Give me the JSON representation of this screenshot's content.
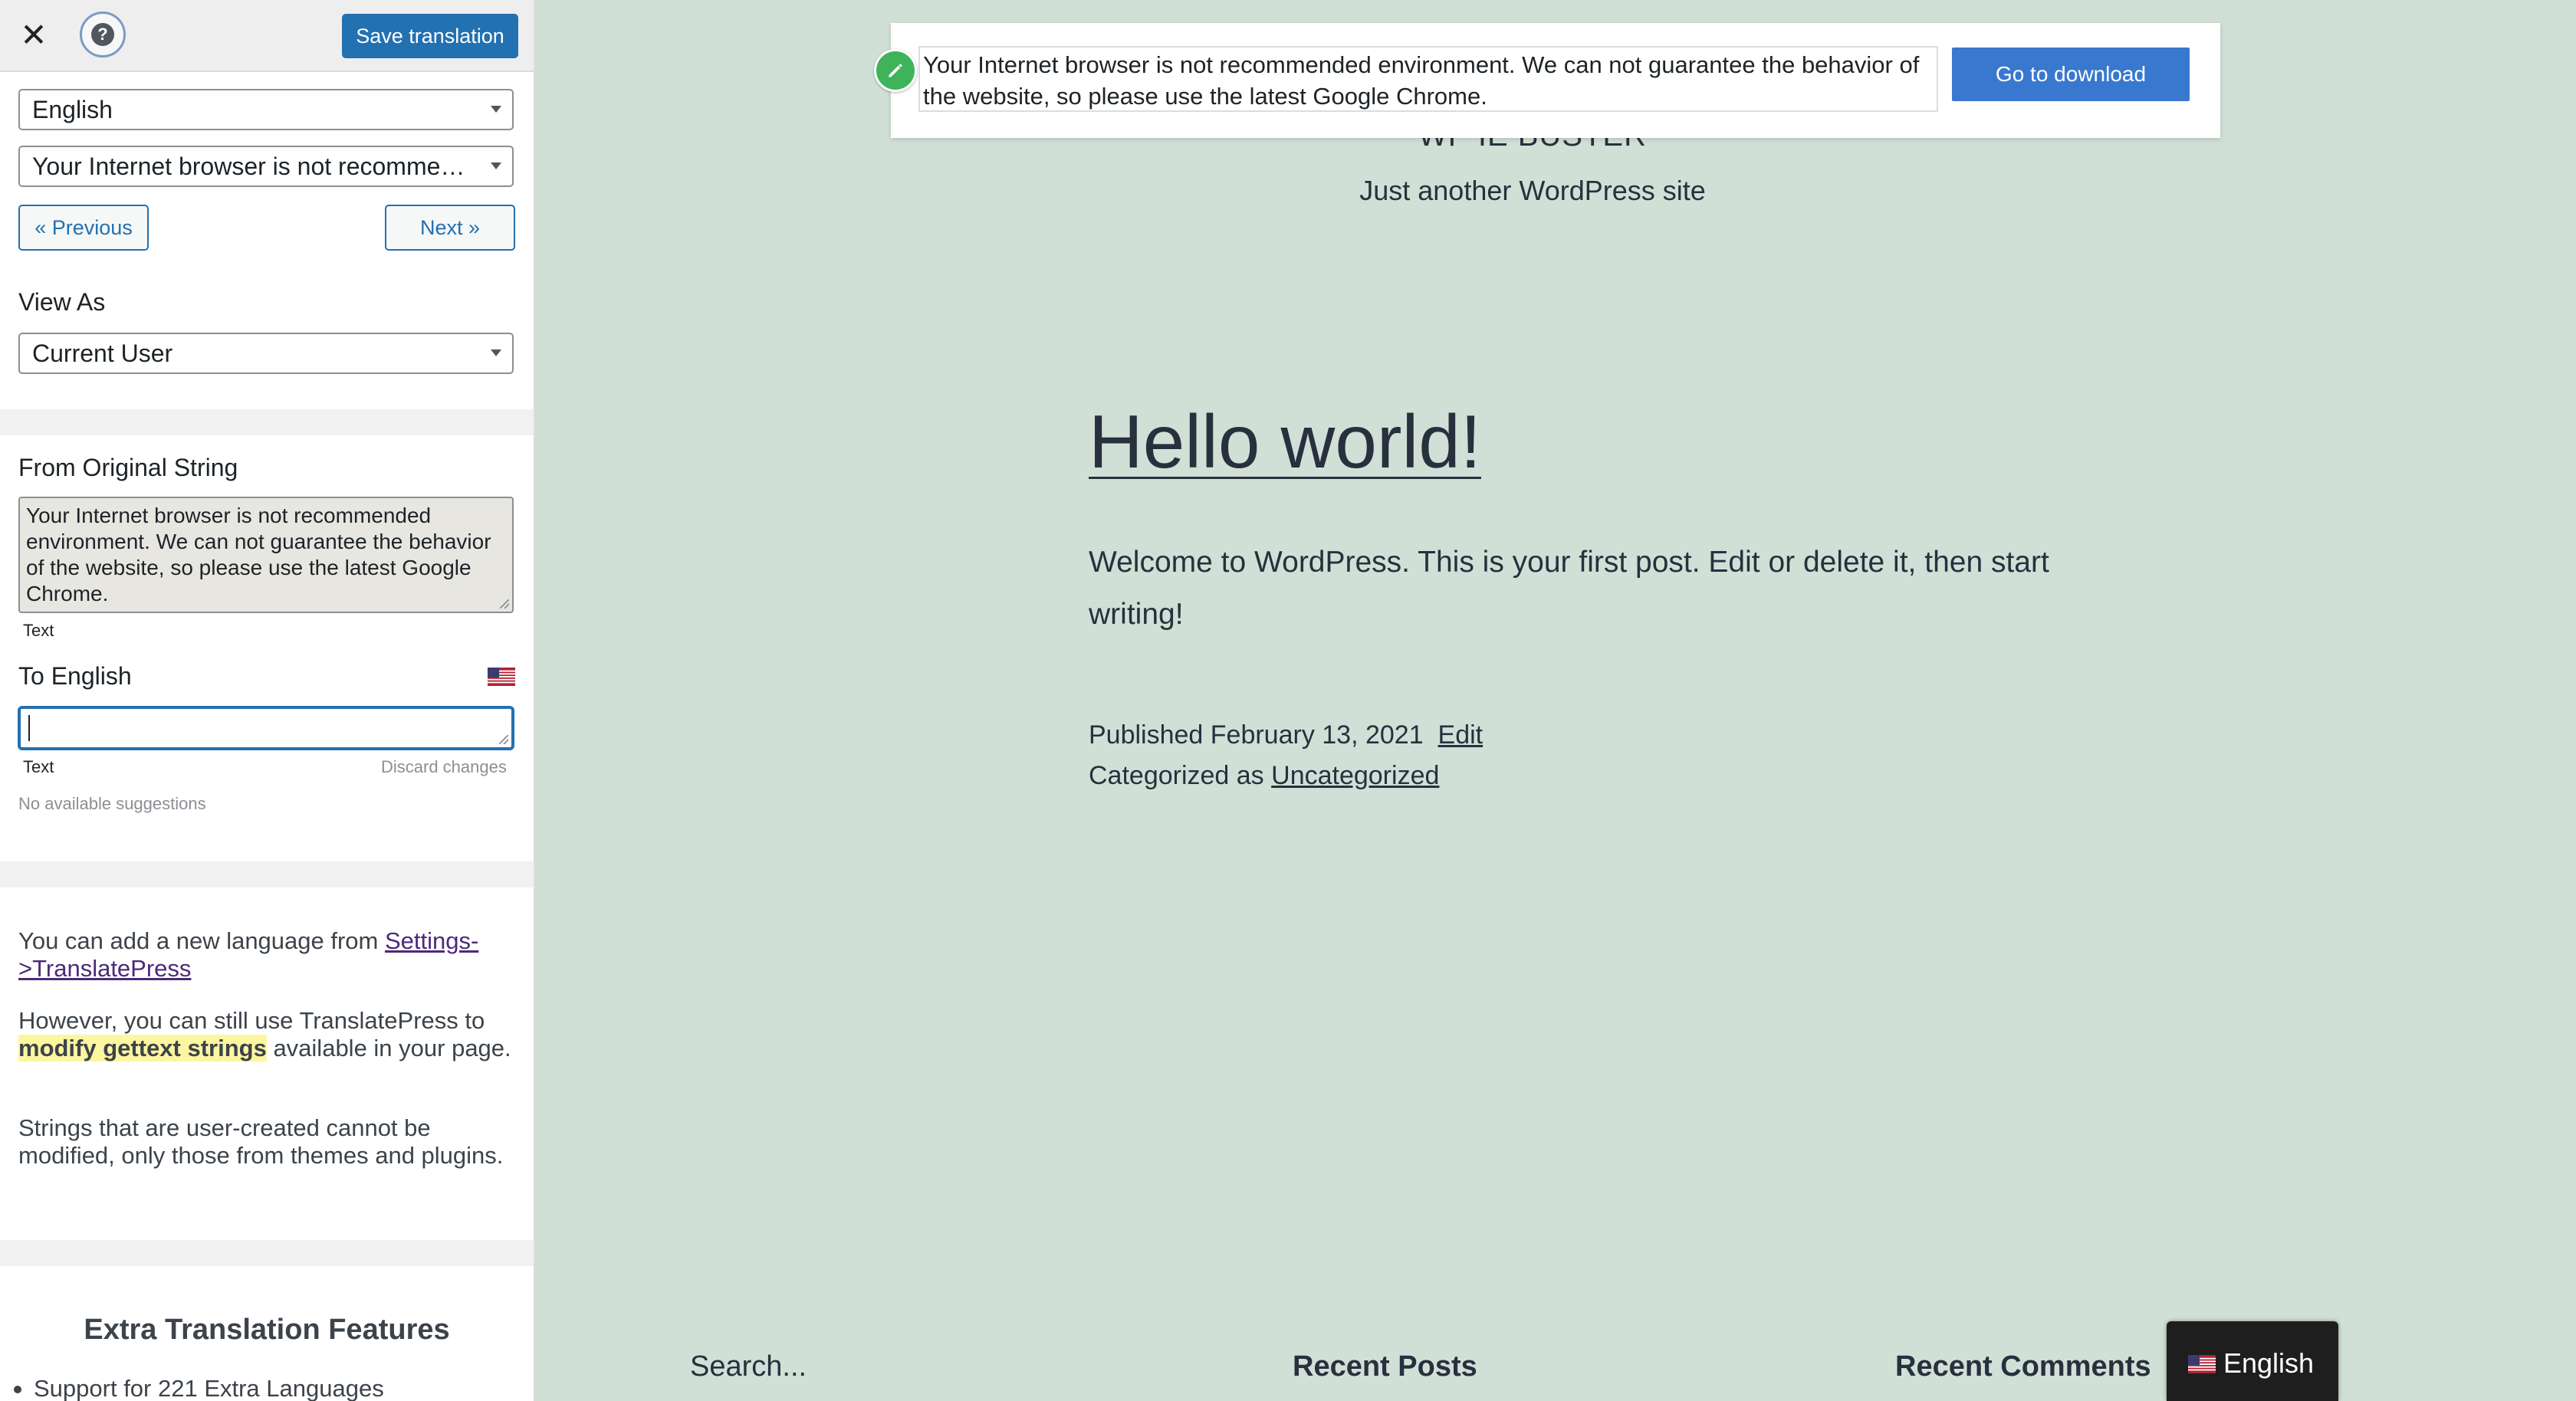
{
  "sidebar": {
    "save_label": "Save translation",
    "language_select": "English",
    "string_select": "Your Internet browser is not recommended environment. We can not guarantee the behavior of the website, so please use the latest Google Chrome.",
    "prev_label": "« Previous",
    "next_label": "Next »",
    "view_as_label": "View As",
    "view_as_value": "Current User",
    "from_label": "From Original String",
    "original_text": "Your Internet browser is not recommended environment. We can not guarantee the behavior of the website, so please use the latest Google Chrome.",
    "text_type_1": "Text",
    "to_label": "To English",
    "translation_value": "",
    "text_type_2": "Text",
    "discard_label": "Discard changes",
    "no_suggestions": "No available suggestions",
    "info1_pre": "You can add a new language from ",
    "info1_link": "Settings->TranslatePress",
    "info2_pre": "However, you can still use TranslatePress to ",
    "info2_highlight": "modify gettext strings",
    "info2_post": " available in your page.",
    "info3": "Strings that are user-created cannot be modified, only those from themes and plugins.",
    "extra_title": "Extra Translation Features",
    "extra_bullet": "Support for 221 Extra Languages"
  },
  "preview": {
    "notice_text": "Your Internet browser is not recommended environment. We can not guarantee the behavior of the website, so please use the latest Google Chrome.",
    "notice_button": "Go to download",
    "site_title": "WP IE BUSTER",
    "site_tagline": "Just another WordPress site",
    "post_title": "Hello world!",
    "post_body": "Welcome to WordPress. This is your first post. Edit or delete it, then start writing!",
    "published_pre": "Published February 13, 2021",
    "edit_link": "Edit",
    "categorized_pre": "Categorized as ",
    "category_link": "Uncategorized",
    "widget_search": "Search...",
    "widget_recent_posts": "Recent Posts",
    "widget_recent_comments": "Recent Comments",
    "lang_switch": "English"
  },
  "colors": {
    "accent": "#2271b1",
    "preview_bg": "#d1e0d7",
    "notice_button": "#3878cf",
    "pencil": "#3eb35a"
  }
}
